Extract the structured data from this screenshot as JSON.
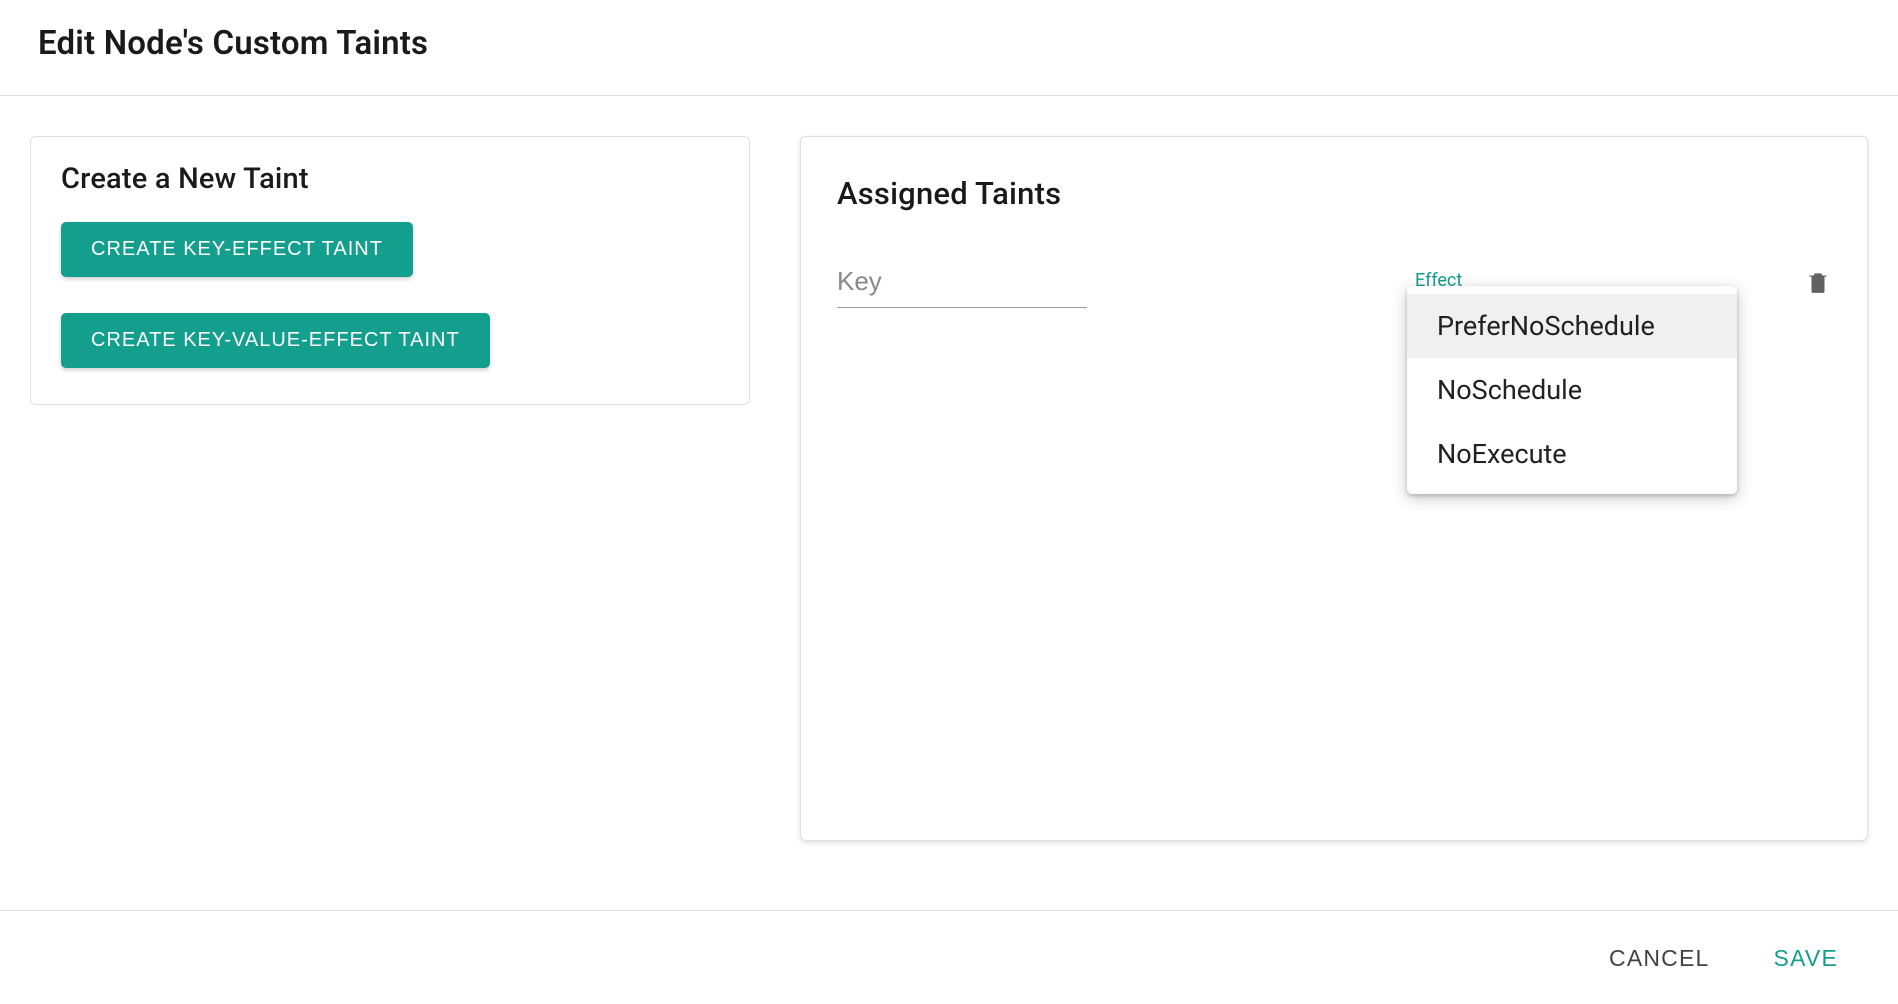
{
  "page_title": "Edit Node's Custom Taints",
  "create_panel": {
    "heading": "Create a New Taint",
    "key_effect_button": "CREATE KEY-EFFECT TAINT",
    "key_value_effect_button": "CREATE KEY-VALUE-EFFECT TAINT"
  },
  "assigned_panel": {
    "heading": "Assigned Taints",
    "key_placeholder": "Key",
    "key_value": "",
    "effect_label": "Effect",
    "effect_options": [
      "PreferNoSchedule",
      "NoSchedule",
      "NoExecute"
    ],
    "effect_selected": "PreferNoSchedule"
  },
  "footer": {
    "cancel": "CANCEL",
    "save": "SAVE"
  },
  "colors": {
    "accent": "#149e8d",
    "border": "#e0e0e0",
    "text_primary": "#212121",
    "text_muted": "#757575"
  }
}
